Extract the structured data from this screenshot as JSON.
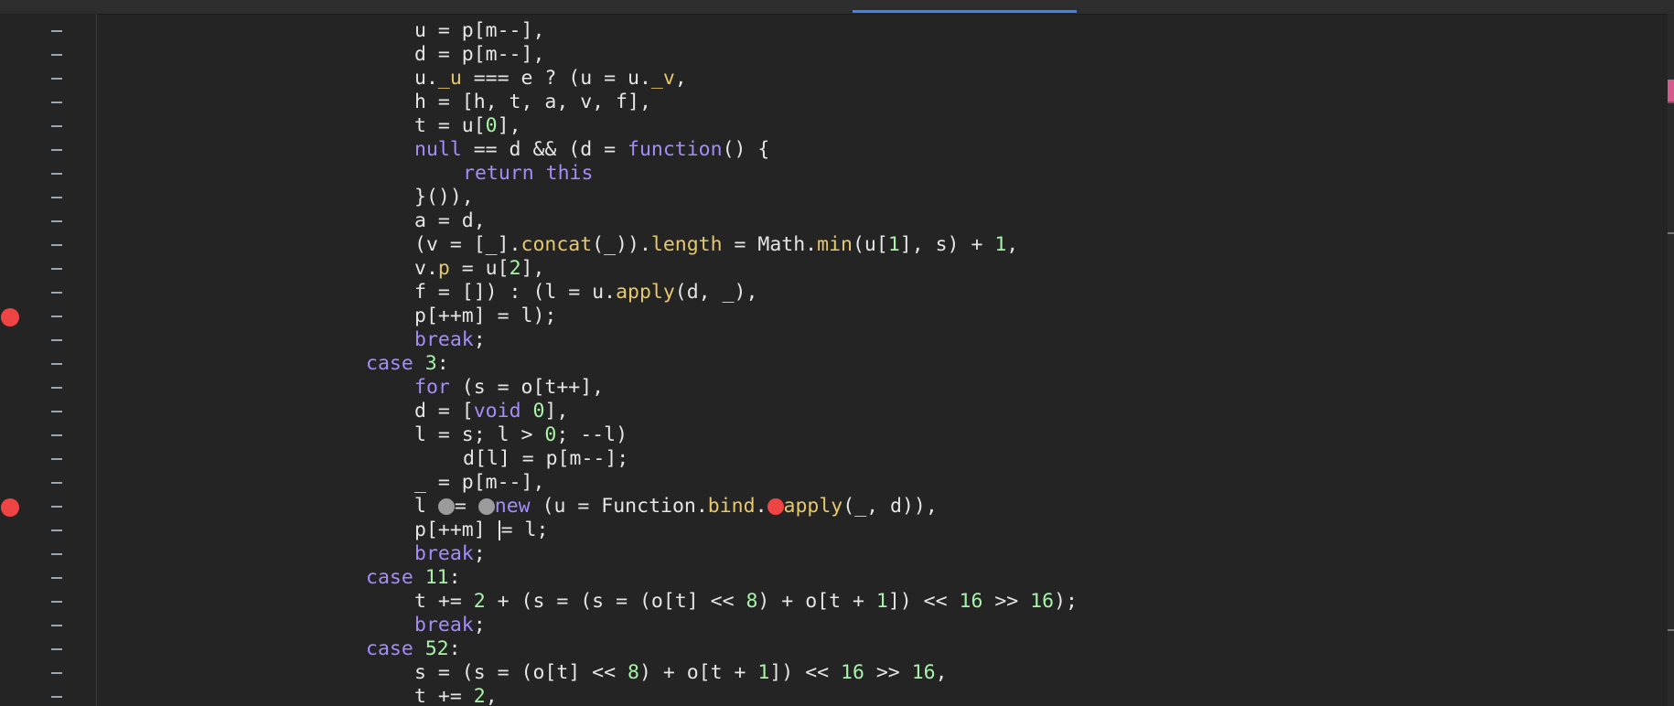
{
  "editor": {
    "lines": [
      {
        "parts": [
          [
            "id",
            "u = p[m--],"
          ]
        ]
      },
      {
        "parts": [
          [
            "id",
            "d = p[m--],"
          ]
        ]
      },
      {
        "parts": [
          [
            "id",
            "u."
          ],
          [
            "fn",
            "_u"
          ],
          [
            "id",
            " === e ? (u = u."
          ],
          [
            "fn",
            "_v"
          ],
          [
            "id",
            ","
          ]
        ]
      },
      {
        "parts": [
          [
            "id",
            "h = [h, t, a, v, f],"
          ]
        ]
      },
      {
        "parts": [
          [
            "id",
            "t = u["
          ],
          [
            "num",
            "0"
          ],
          [
            "id",
            "],"
          ]
        ]
      },
      {
        "parts": [
          [
            "kw",
            "null"
          ],
          [
            "id",
            " == d && (d = "
          ],
          [
            "kw",
            "function"
          ],
          [
            "id",
            "() {"
          ]
        ]
      },
      {
        "parts": [
          [
            "kw",
            "return"
          ],
          [
            "id",
            " "
          ],
          [
            "kw",
            "this"
          ]
        ]
      },
      {
        "parts": [
          [
            "id",
            "}()),"
          ]
        ]
      },
      {
        "parts": [
          [
            "id",
            "a = d,"
          ]
        ]
      },
      {
        "parts": [
          [
            "id",
            "(v = [_]."
          ],
          [
            "fn",
            "concat"
          ],
          [
            "id",
            "(_))."
          ],
          [
            "fn",
            "length"
          ],
          [
            "id",
            " = Math."
          ],
          [
            "fn",
            "min"
          ],
          [
            "id",
            "(u["
          ],
          [
            "num",
            "1"
          ],
          [
            "id",
            "], s) + "
          ],
          [
            "num",
            "1"
          ],
          [
            "id",
            ","
          ]
        ]
      },
      {
        "parts": [
          [
            "id",
            "v."
          ],
          [
            "fn",
            "p"
          ],
          [
            "id",
            " = u["
          ],
          [
            "num",
            "2"
          ],
          [
            "id",
            "],"
          ]
        ]
      },
      {
        "parts": [
          [
            "id",
            "f = []) : (l = u."
          ],
          [
            "fn",
            "apply"
          ],
          [
            "id",
            "(d, _),"
          ]
        ]
      },
      {
        "parts": [
          [
            "id",
            "p[++m] = l);"
          ]
        ]
      },
      {
        "parts": [
          [
            "kw",
            "break"
          ],
          [
            "id",
            ";"
          ]
        ]
      },
      {
        "parts": [
          [
            "kw",
            "case"
          ],
          [
            "id",
            " "
          ],
          [
            "num",
            "3"
          ],
          [
            "id",
            ":"
          ]
        ]
      },
      {
        "parts": [
          [
            "kw",
            "for"
          ],
          [
            "id",
            " (s = o[t++],"
          ]
        ]
      },
      {
        "parts": [
          [
            "id",
            "d = ["
          ],
          [
            "kw",
            "void"
          ],
          [
            "id",
            " "
          ],
          [
            "num",
            "0"
          ],
          [
            "id",
            "],"
          ]
        ]
      },
      {
        "parts": [
          [
            "id",
            "l = s; l > "
          ],
          [
            "num",
            "0"
          ],
          [
            "id",
            "; --l)"
          ]
        ]
      },
      {
        "parts": [
          [
            "id",
            "d[l] = p[m--];"
          ]
        ]
      },
      {
        "parts": [
          [
            "id",
            "_ = p[m--],"
          ]
        ]
      },
      {
        "parts": [
          [
            "id",
            "l "
          ],
          [
            "graydot",
            ""
          ],
          [
            "id",
            "= "
          ],
          [
            "graydot",
            ""
          ],
          [
            "kw",
            "new"
          ],
          [
            "id",
            " (u = Function."
          ],
          [
            "fn",
            "bind"
          ],
          [
            "id",
            "."
          ],
          [
            "reddot",
            ""
          ],
          [
            "fn",
            "apply"
          ],
          [
            "id",
            "(_, d)),"
          ]
        ]
      },
      {
        "parts": [
          [
            "id",
            "p[++m] "
          ],
          [
            "cursor",
            ""
          ],
          [
            "id",
            "= l;"
          ]
        ]
      },
      {
        "parts": [
          [
            "kw",
            "break"
          ],
          [
            "id",
            ";"
          ]
        ]
      },
      {
        "parts": [
          [
            "kw",
            "case"
          ],
          [
            "id",
            " "
          ],
          [
            "num",
            "11"
          ],
          [
            "id",
            ":"
          ]
        ]
      },
      {
        "parts": [
          [
            "id",
            "t += "
          ],
          [
            "num",
            "2"
          ],
          [
            "id",
            " + (s = (s = (o[t] << "
          ],
          [
            "num",
            "8"
          ],
          [
            "id",
            ") + o[t + "
          ],
          [
            "num",
            "1"
          ],
          [
            "id",
            "]) << "
          ],
          [
            "num",
            "16"
          ],
          [
            "id",
            " >> "
          ],
          [
            "num",
            "16"
          ],
          [
            "id",
            ");"
          ]
        ]
      },
      {
        "parts": [
          [
            "kw",
            "break"
          ],
          [
            "id",
            ";"
          ]
        ]
      },
      {
        "parts": [
          [
            "kw",
            "case"
          ],
          [
            "id",
            " "
          ],
          [
            "num",
            "52"
          ],
          [
            "id",
            ":"
          ]
        ]
      },
      {
        "parts": [
          [
            "id",
            "s = (s = (o[t] << "
          ],
          [
            "num",
            "8"
          ],
          [
            "id",
            ") + o[t + "
          ],
          [
            "num",
            "1"
          ],
          [
            "id",
            "]) << "
          ],
          [
            "num",
            "16"
          ],
          [
            "id",
            " >> "
          ],
          [
            "num",
            "16"
          ],
          [
            "id",
            ","
          ]
        ]
      },
      {
        "parts": [
          [
            "id",
            "t += "
          ],
          [
            "num",
            "2"
          ],
          [
            "id",
            ","
          ]
        ]
      }
    ]
  },
  "gutter": {
    "breakpoint_lines": [
      12,
      20
    ]
  },
  "colors": {
    "background": "#242424",
    "keyword": "#a78bfa",
    "number": "#a7f3a7",
    "function": "#e7c86a",
    "identifier": "#e6e6e6",
    "breakpoint": "#ef4444"
  }
}
